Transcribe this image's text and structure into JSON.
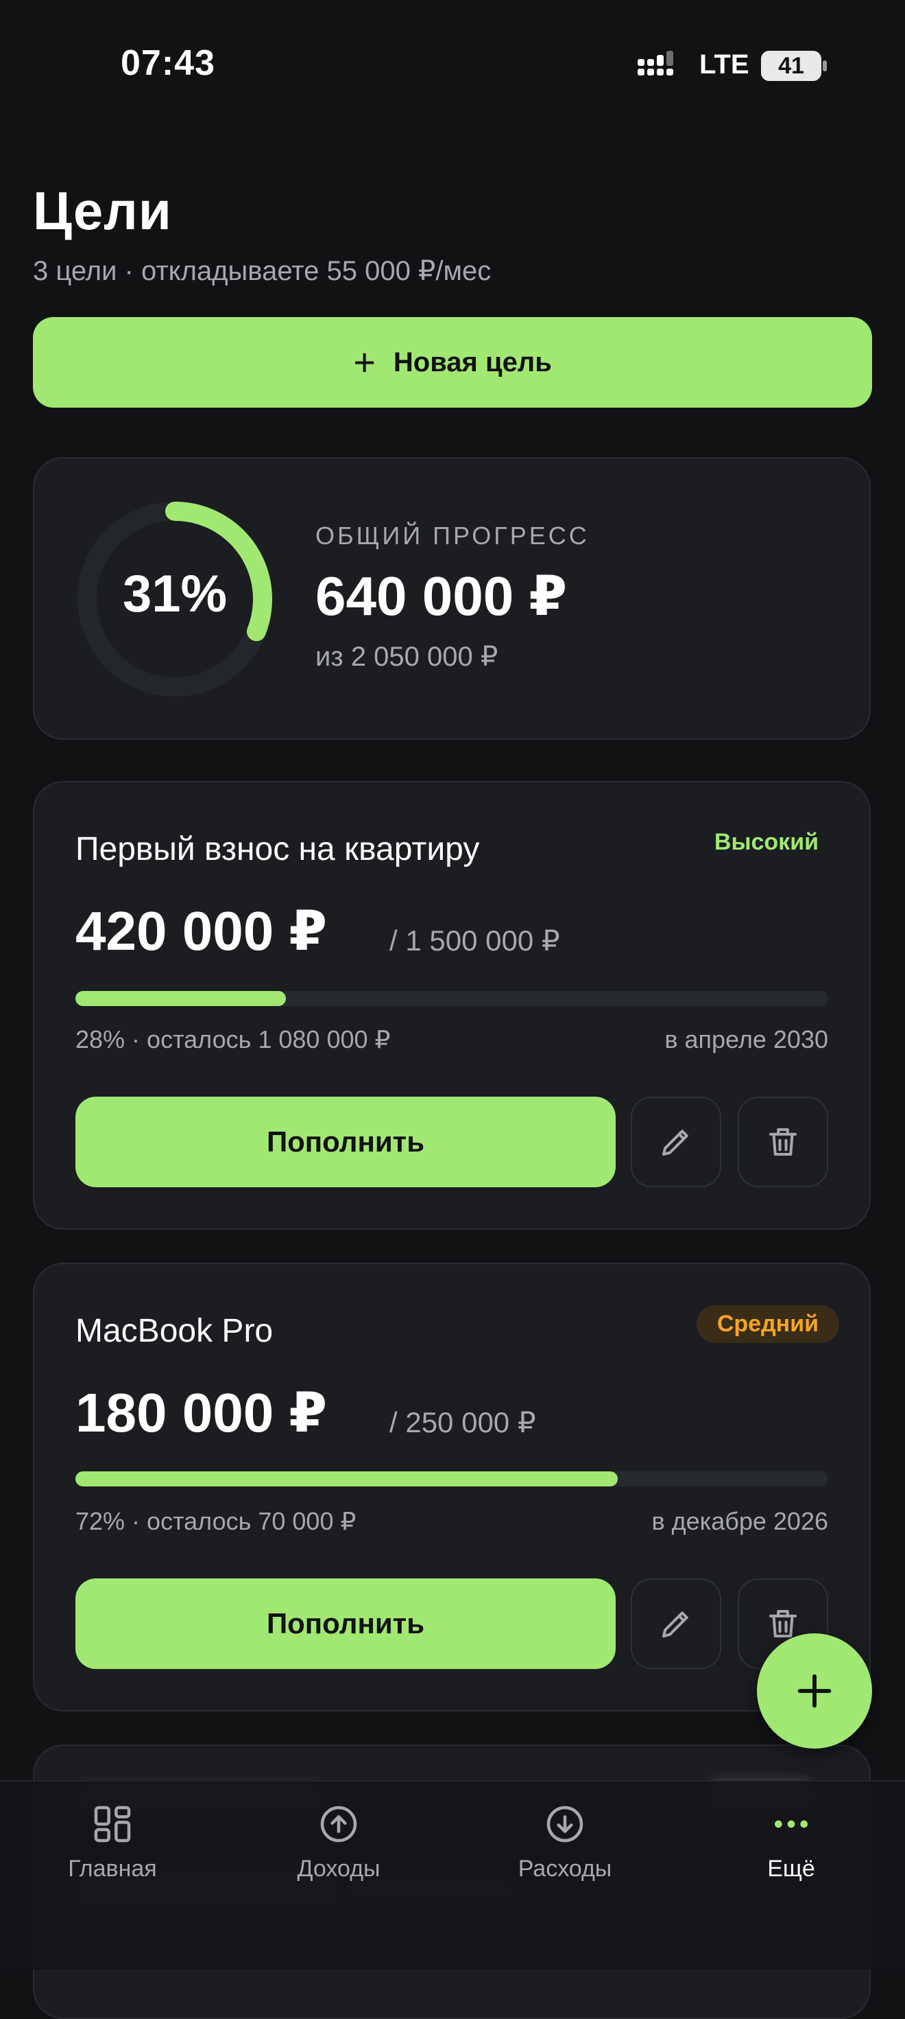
{
  "status_bar": {
    "time": "07:43",
    "network": "LTE",
    "battery": "41",
    "battery_level": 0.41
  },
  "header": {
    "title": "Цели",
    "subtitle": "3 цели · откладываете 55 000 ₽/мес",
    "new_goal_label": "Новая цель"
  },
  "summary": {
    "percent_label": "31%",
    "progress": 0.31,
    "label": "ОБЩИЙ ПРОГРЕСС",
    "amount": "640 000 ₽",
    "total": "из 2 050 000 ₽"
  },
  "goals": [
    {
      "name": "Первый взнос на квартиру",
      "priority": "Высокий",
      "priority_color": "#a1e872",
      "amount": "420 000 ₽",
      "total": "/ 1 500 000 ₽",
      "progress": 0.28,
      "meta_left": "28% · осталось 1 080 000 ₽",
      "meta_right": "в апреле 2030",
      "topup_label": "Пополнить"
    },
    {
      "name": "MacBook Pro",
      "priority": "Средний",
      "priority_color": "#f5a524",
      "amount": "180 000 ₽",
      "total": "/ 250 000 ₽",
      "progress": 0.72,
      "meta_left": "72% · осталось 70 000 ₽",
      "meta_right": "в декабре 2026",
      "topup_label": "Пополнить"
    }
  ],
  "nav": {
    "items": [
      {
        "label": "Главная",
        "icon": "grid-icon"
      },
      {
        "label": "Доходы",
        "icon": "arrow-up-circle-icon"
      },
      {
        "label": "Расходы",
        "icon": "arrow-down-circle-icon"
      },
      {
        "label": "Ещё",
        "icon": "more-dots-icon",
        "active": true
      }
    ]
  },
  "colors": {
    "accent": "#a1e872",
    "background": "#111214",
    "card": "#1b1d21"
  }
}
